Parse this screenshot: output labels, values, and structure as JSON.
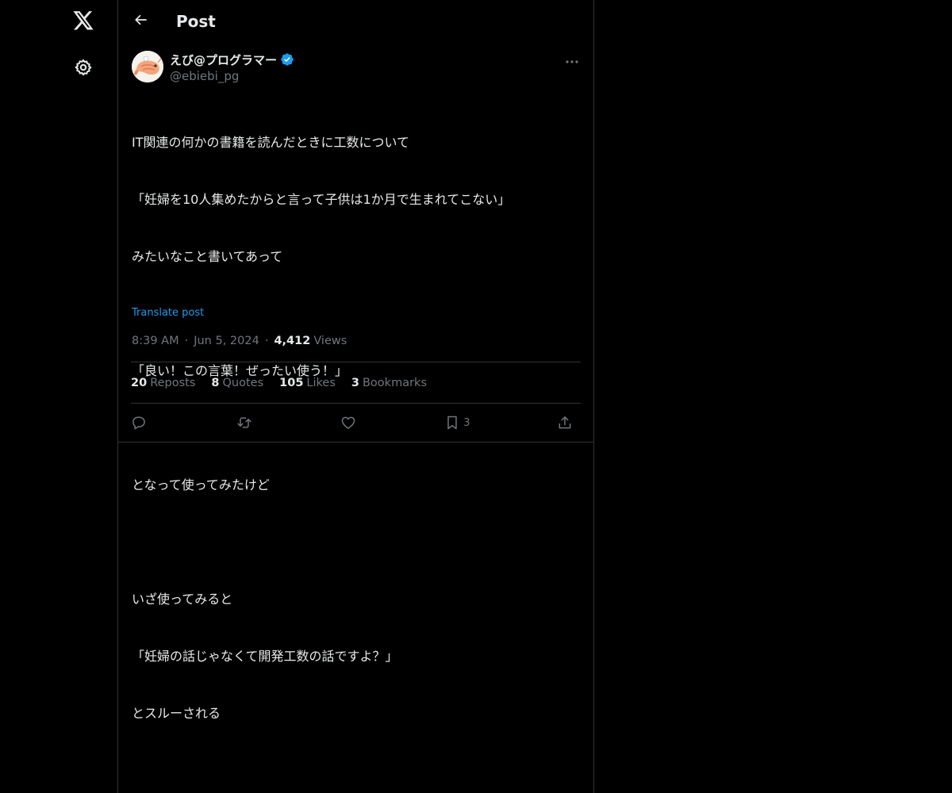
{
  "nav": {
    "logo_icon": "x-logo-icon",
    "settings_icon": "gear-icon"
  },
  "header": {
    "title": "Post",
    "back_icon": "arrow-left-icon"
  },
  "post": {
    "author": {
      "display_name": "えび@プログラマー",
      "handle": "@ebiebi_pg",
      "verified": true
    },
    "lines": [
      "IT関連の何かの書籍を読んだときに工数について",
      "「妊婦を10人集めたからと言って子供は1か月で生まれてこない」",
      "みたいなこと書いてあって",
      "",
      "「良い！この言葉！ぜったい使う！」",
      "",
      "となって使ってみたけど",
      "",
      "いざ使ってみると",
      "「妊婦の話じゃなくて開発工数の話ですよ？」",
      "とスルーされる"
    ],
    "translate_label": "Translate post",
    "time": "8:39 AM",
    "date": "Jun 5, 2024",
    "views_count": "4,412",
    "views_label": "Views",
    "separator": "·"
  },
  "stats": {
    "reposts": {
      "count": "20",
      "label": "Reposts"
    },
    "quotes": {
      "count": "8",
      "label": "Quotes"
    },
    "likes": {
      "count": "105",
      "label": "Likes"
    },
    "bookmarks": {
      "count": "3",
      "label": "Bookmarks"
    }
  },
  "actions": {
    "reply_icon": "reply-icon",
    "repost_icon": "repost-icon",
    "like_icon": "heart-icon",
    "bookmark_icon": "bookmark-icon",
    "bookmark_count": "3",
    "share_icon": "share-icon"
  },
  "colors": {
    "background": "#000000",
    "text": "#e7e9ea",
    "muted": "#71767b",
    "border": "#2f3336",
    "accent": "#1d9bf0"
  }
}
